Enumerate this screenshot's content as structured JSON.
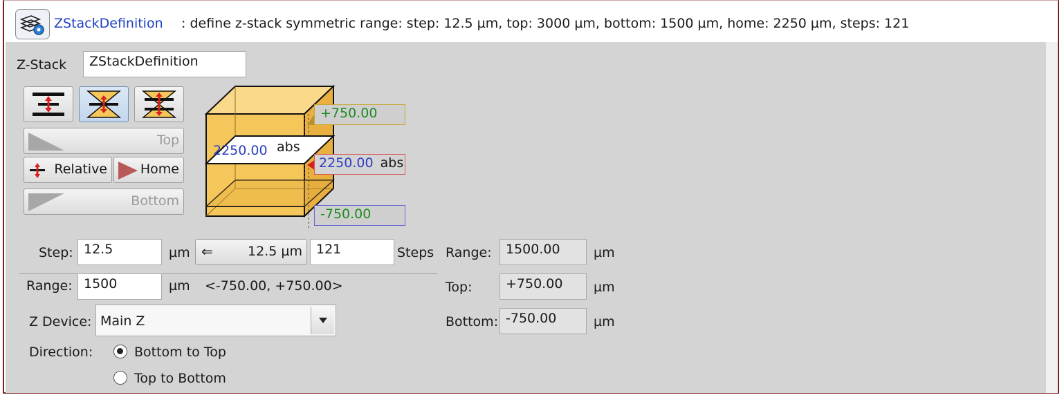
{
  "header": {
    "icon": "zstack-gear-icon",
    "name": "ZStackDefinition",
    "description": ": define z-stack symmetric range: step: 12.5 µm, top: 3000 µm, bottom: 1500 µm, home: 2250 µm, steps: 121"
  },
  "zstack": {
    "label": "Z-Stack",
    "name_value": "ZStackDefinition"
  },
  "mode_buttons": [
    {
      "icon": "symmetric-range-icon"
    },
    {
      "icon": "center-range-icon"
    },
    {
      "icon": "top-bottom-range-icon"
    }
  ],
  "buttons": {
    "top": "Top",
    "relative": "Relative",
    "home": "Home",
    "bottom": "Bottom"
  },
  "cube": {
    "top_offset": "+750.00",
    "home_value": "2250.00",
    "home_unit": "abs",
    "plane_value": "2250.00",
    "plane_unit": "abs",
    "bottom_offset": "-750.00"
  },
  "step": {
    "label": "Step:",
    "value": "12.5",
    "unit": "µm",
    "apply_button": "12.5 µm",
    "steps_value": "121",
    "steps_label": "Steps"
  },
  "range": {
    "label": "Range:",
    "value": "1500",
    "unit": "µm",
    "interval": "<-750.00, +750.00>"
  },
  "z_device": {
    "label": "Z Device:",
    "selected": "Main Z"
  },
  "direction": {
    "label": "Direction:",
    "options": [
      "Bottom to Top",
      "Top to Bottom"
    ],
    "selected": "Bottom to Top"
  },
  "summary": {
    "range_label": "Range:",
    "range_value": "1500.00",
    "top_label": "Top:",
    "top_value": "+750.00",
    "bottom_label": "Bottom:",
    "bottom_value": "-750.00",
    "unit": "µm"
  },
  "colors": {
    "accent": "#1f3fbf",
    "cube": "#f5c75a",
    "offset_text": "#1f8a1f",
    "border": "#7a1c1c"
  }
}
